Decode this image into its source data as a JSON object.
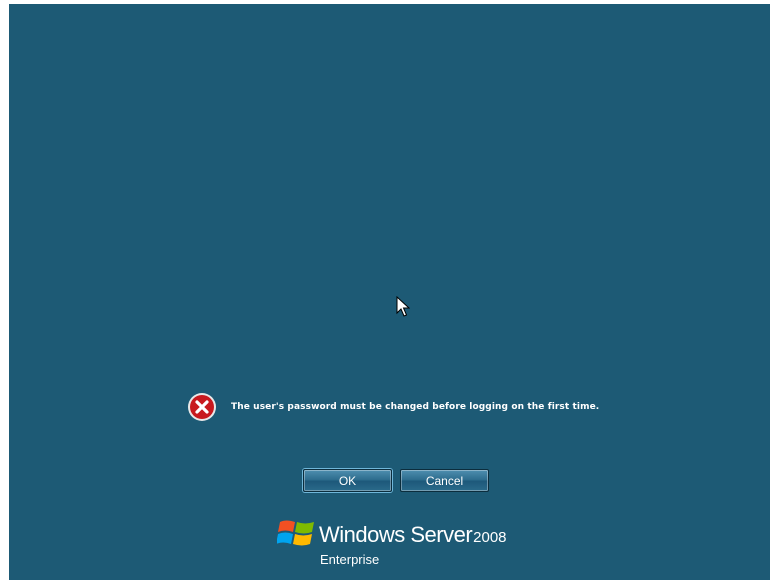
{
  "message": {
    "icon": "error-icon",
    "text": "The user's password must be changed before logging on the first time."
  },
  "buttons": {
    "ok_label": "OK",
    "cancel_label": "Cancel"
  },
  "branding": {
    "product": "Windows Server",
    "version": "2008",
    "edition": "Enterprise",
    "icon": "windows-flag-icon"
  },
  "colors": {
    "background": "#1d5a75",
    "error_icon": "#c8191e",
    "text": "#ffffff"
  }
}
